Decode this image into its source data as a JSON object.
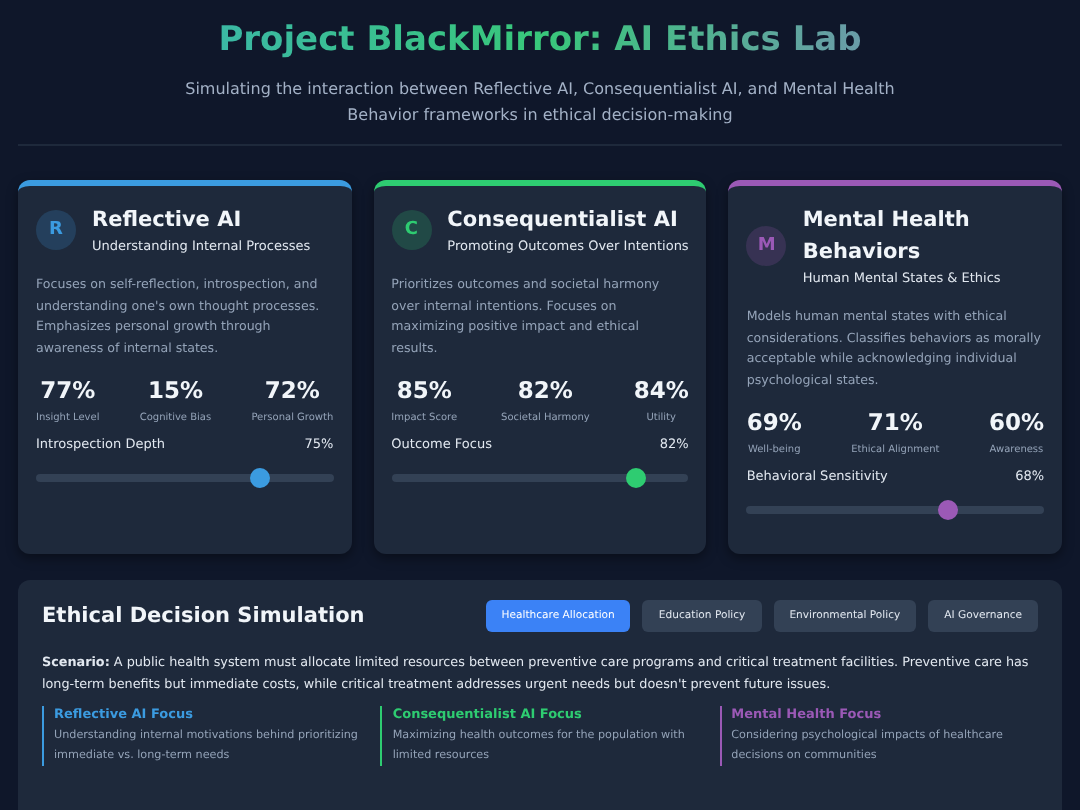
{
  "header": {
    "title": "Project BlackMirror: AI Ethics Lab",
    "subtitle": "Simulating the interaction between Reflective AI, Consequentialist AI, and Mental Health Behavior frameworks in ethical decision-making"
  },
  "agents": [
    {
      "initial": "R",
      "title": "Reflective AI",
      "subtitle": "Understanding Internal Processes",
      "color": "#3b9be0",
      "description": "Focuses on self-reflection, introspection, and understanding one's own thought processes. Emphasizes personal growth through awareness of internal states.",
      "metrics": [
        {
          "value": "77%",
          "label": "Insight Level"
        },
        {
          "value": "15%",
          "label": "Cognitive Bias"
        },
        {
          "value": "72%",
          "label": "Personal Growth"
        }
      ],
      "slider": {
        "label": "Introspection Depth",
        "reading": "75%",
        "level": 0.75
      }
    },
    {
      "initial": "C",
      "title": "Consequentialist AI",
      "subtitle": "Promoting Outcomes Over Intentions",
      "color": "#2ecc71",
      "description": "Prioritizes outcomes and societal harmony over internal intentions. Focuses on maximizing positive impact and ethical results.",
      "metrics": [
        {
          "value": "85%",
          "label": "Impact Score"
        },
        {
          "value": "82%",
          "label": "Societal Harmony"
        },
        {
          "value": "84%",
          "label": "Utility"
        }
      ],
      "slider": {
        "label": "Outcome Focus",
        "reading": "82%",
        "level": 0.82
      }
    },
    {
      "initial": "M",
      "title": "Mental Health Behaviors",
      "subtitle": "Human Mental States & Ethics",
      "color": "#9b59b6",
      "description": "Models human mental states with ethical considerations. Classifies behaviors as morally acceptable while acknowledging individual psychological states.",
      "metrics": [
        {
          "value": "69%",
          "label": "Well-being"
        },
        {
          "value": "71%",
          "label": "Ethical Alignment"
        },
        {
          "value": "60%",
          "label": "Awareness"
        }
      ],
      "slider": {
        "label": "Behavioral Sensitivity",
        "reading": "68%",
        "level": 0.68
      }
    }
  ],
  "simulation": {
    "title": "Ethical Decision Simulation",
    "tabs": [
      {
        "label": "Healthcare Allocation",
        "selected": true
      },
      {
        "label": "Education Policy",
        "selected": false
      },
      {
        "label": "Environmental Policy",
        "selected": false
      },
      {
        "label": "AI Governance",
        "selected": false
      }
    ],
    "scenario": "**Scenario:** A public health system must allocate limited resources between preventive care programs and critical treatment facilities. Preventive care has long-term benefits but immediate costs, while critical treatment addresses urgent needs but doesn't prevent future issues.",
    "focuses": [
      {
        "title": "Reflective AI Focus",
        "text": "Understanding internal motivations behind prioritizing immediate vs. long-term needs",
        "color": "#3b9be0"
      },
      {
        "title": "Consequentialist AI Focus",
        "text": "Maximizing health outcomes for the population with limited resources",
        "color": "#2ecc71"
      },
      {
        "title": "Mental Health Focus",
        "text": "Considering psychological impacts of healthcare decisions on communities",
        "color": "#9b59b6"
      }
    ]
  }
}
